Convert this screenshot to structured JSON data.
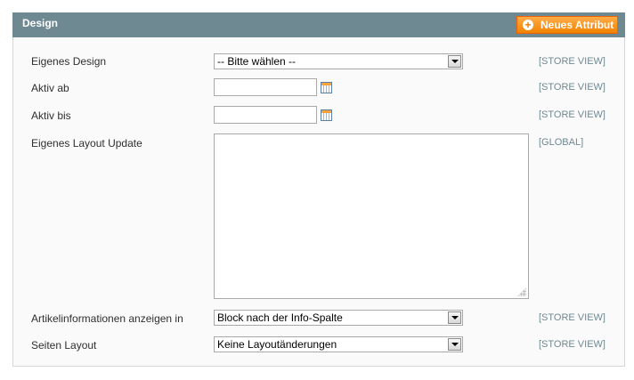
{
  "header": {
    "title": "Design",
    "add_button_label": "Neues Attribut"
  },
  "rows": [
    {
      "label": "Eigenes Design",
      "control": "select",
      "value": "-- Bitte wählen --",
      "scope": "[STORE VIEW]"
    },
    {
      "label": "Aktiv ab",
      "control": "date",
      "value": "",
      "scope": "[STORE VIEW]"
    },
    {
      "label": "Aktiv bis",
      "control": "date",
      "value": "",
      "scope": "[STORE VIEW]"
    },
    {
      "label": "Eigenes Layout Update",
      "control": "textarea",
      "value": "",
      "scope": "[GLOBAL]"
    },
    {
      "label": "Artikelinformationen anzeigen in",
      "control": "select",
      "value": "Block nach der Info-Spalte",
      "scope": "[STORE VIEW]"
    },
    {
      "label": "Seiten Layout",
      "control": "select",
      "value": "Keine Layoutänderungen",
      "scope": "[STORE VIEW]"
    }
  ],
  "colors": {
    "header_bg": "#6f8992",
    "button_bg": "#f18200",
    "scope_text": "#6f8992"
  },
  "icons": [
    "plus-circle-icon",
    "calendar-icon",
    "dropdown-arrow-icon",
    "resize-grip-icon"
  ]
}
